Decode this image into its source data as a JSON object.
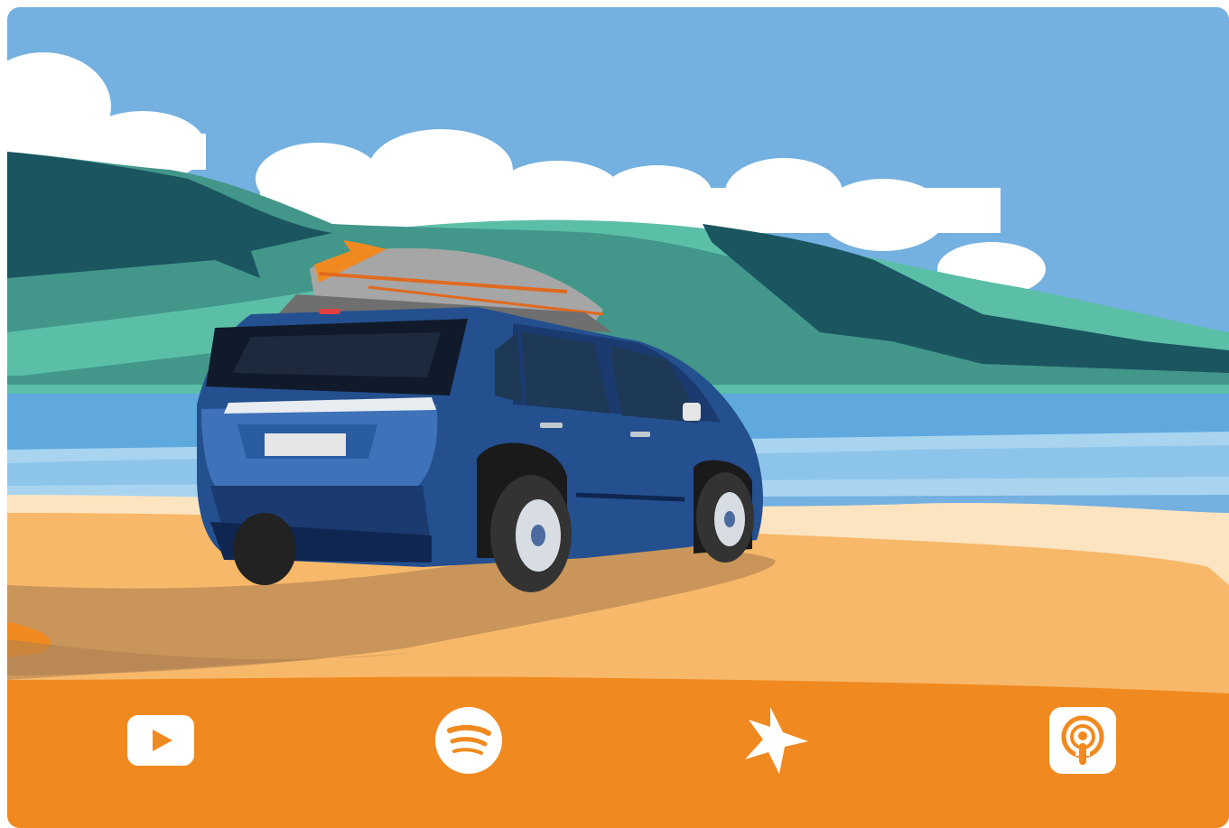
{
  "scene": {
    "illustration": "car-on-beach-illustration",
    "colors": {
      "sky": "#74b0e0",
      "cloud": "#ffffff",
      "hill_light": "#5bbfa8",
      "hill_mid": "#42968a",
      "hill_dark": "#1a5560",
      "water": "#5fa9df",
      "water_light": "#a8d4f0",
      "sand_light": "#fde4c0",
      "sand": "#f7b86a",
      "shadow": "#c9955a",
      "footer": "#f08a20",
      "car_body": "#24508f",
      "car_dark": "#1a3a70",
      "board": "#a6a6a6"
    }
  },
  "services": [
    {
      "id": "youtube",
      "icon": "youtube-icon"
    },
    {
      "id": "spotify",
      "icon": "spotify-icon"
    },
    {
      "id": "iheart-star",
      "icon": "star-icon"
    },
    {
      "id": "apple-podcasts",
      "icon": "podcast-icon"
    }
  ]
}
